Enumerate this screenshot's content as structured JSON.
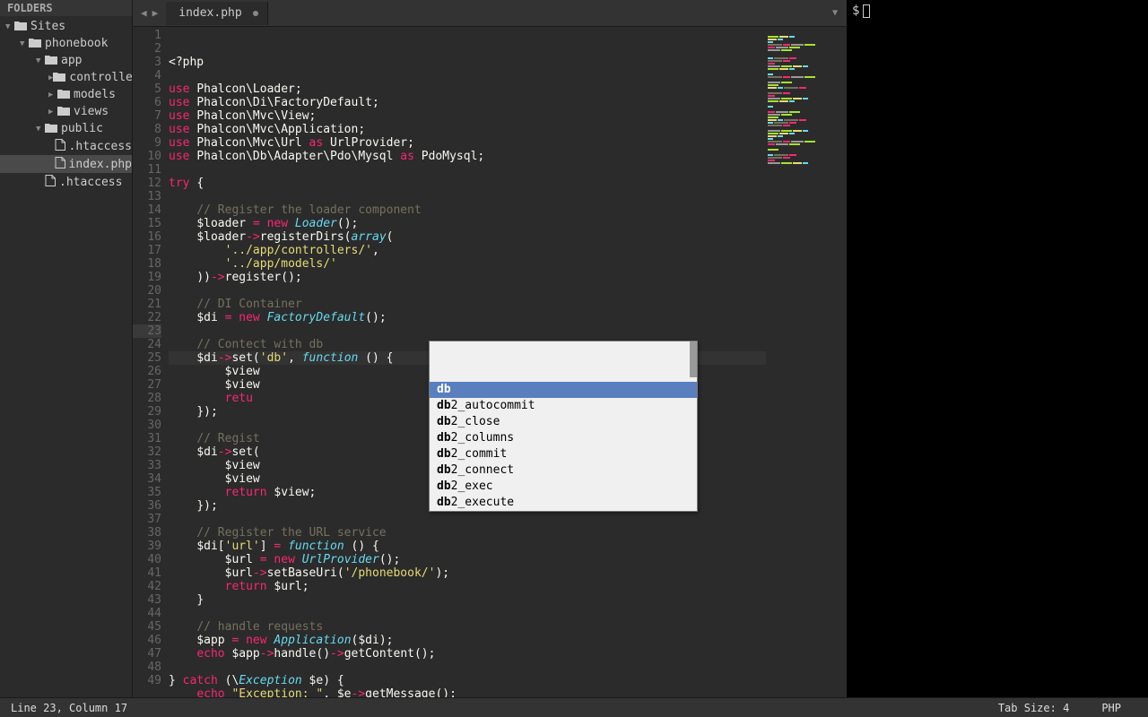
{
  "sidebar": {
    "header": "FOLDERS",
    "tree": [
      {
        "label": "Sites",
        "depth": 0,
        "type": "folder",
        "expanded": true,
        "selected": false
      },
      {
        "label": "phonebook",
        "depth": 1,
        "type": "folder",
        "expanded": true,
        "selected": false
      },
      {
        "label": "app",
        "depth": 2,
        "type": "folder",
        "expanded": true,
        "selected": false
      },
      {
        "label": "controllers",
        "depth": 3,
        "type": "folder",
        "expanded": false,
        "selected": false
      },
      {
        "label": "models",
        "depth": 3,
        "type": "folder",
        "expanded": false,
        "selected": false
      },
      {
        "label": "views",
        "depth": 3,
        "type": "folder",
        "expanded": false,
        "selected": false
      },
      {
        "label": "public",
        "depth": 2,
        "type": "folder",
        "expanded": true,
        "selected": false
      },
      {
        "label": ".htaccess",
        "depth": 3,
        "type": "file",
        "expanded": false,
        "selected": false
      },
      {
        "label": "index.php",
        "depth": 3,
        "type": "file",
        "expanded": false,
        "selected": true
      },
      {
        "label": ".htaccess",
        "depth": 2,
        "type": "file",
        "expanded": false,
        "selected": false
      }
    ]
  },
  "tabs": {
    "active": {
      "title": "index.php",
      "dirty": true
    }
  },
  "autocomplete": {
    "items": [
      {
        "prefix": "db",
        "suffix": "",
        "selected": true
      },
      {
        "prefix": "db",
        "suffix": "2_autocommit",
        "selected": false
      },
      {
        "prefix": "db",
        "suffix": "2_close",
        "selected": false
      },
      {
        "prefix": "db",
        "suffix": "2_columns",
        "selected": false
      },
      {
        "prefix": "db",
        "suffix": "2_commit",
        "selected": false
      },
      {
        "prefix": "db",
        "suffix": "2_connect",
        "selected": false
      },
      {
        "prefix": "db",
        "suffix": "2_exec",
        "selected": false
      },
      {
        "prefix": "db",
        "suffix": "2_execute",
        "selected": false
      }
    ]
  },
  "code": {
    "current_line": 23,
    "lines": [
      {
        "n": 1,
        "html": "<span class='k-white'>&lt;?php</span>"
      },
      {
        "n": 2,
        "html": ""
      },
      {
        "n": 3,
        "html": "<span class='k-red'>use</span> <span class='k-white'>Phalcon\\Loader;</span>"
      },
      {
        "n": 4,
        "html": "<span class='k-red'>use</span> <span class='k-white'>Phalcon\\Di\\FactoryDefault;</span>"
      },
      {
        "n": 5,
        "html": "<span class='k-red'>use</span> <span class='k-white'>Phalcon\\Mvc\\View;</span>"
      },
      {
        "n": 6,
        "html": "<span class='k-red'>use</span> <span class='k-white'>Phalcon\\Mvc\\Application;</span>"
      },
      {
        "n": 7,
        "html": "<span class='k-red'>use</span> <span class='k-white'>Phalcon\\Mvc\\Url </span><span class='k-red'>as</span><span class='k-white'> UrlProvider;</span>"
      },
      {
        "n": 8,
        "html": "<span class='k-red'>use</span> <span class='k-white'>Phalcon\\Db\\Adapter\\Pdo\\Mysql </span><span class='k-red'>as</span><span class='k-white'> PdoMysql;</span>"
      },
      {
        "n": 9,
        "html": ""
      },
      {
        "n": 10,
        "html": "<span class='k-red'>try</span> <span class='k-white'>{</span>"
      },
      {
        "n": 11,
        "html": ""
      },
      {
        "n": 12,
        "html": "    <span class='k-gray'>// Register the loader component</span>"
      },
      {
        "n": 13,
        "html": "    <span class='k-white'>$loader </span><span class='k-red'>=</span> <span class='k-red'>new</span> <span class='k-blue'>Loader</span><span class='k-white'>();</span>"
      },
      {
        "n": 14,
        "html": "    <span class='k-white'>$loader</span><span class='k-red'>-&gt;</span><span class='k-white'>registerDirs(</span><span class='k-blue'>array</span><span class='k-white'>(</span>"
      },
      {
        "n": 15,
        "html": "        <span class='k-yellow'>'../app/controllers/'</span><span class='k-white'>,</span>"
      },
      {
        "n": 16,
        "html": "        <span class='k-yellow'>'../app/models/'</span>"
      },
      {
        "n": 17,
        "html": "    <span class='k-white'>))</span><span class='k-red'>-&gt;</span><span class='k-white'>register();</span>"
      },
      {
        "n": 18,
        "html": ""
      },
      {
        "n": 19,
        "html": "    <span class='k-gray'>// DI Container</span>"
      },
      {
        "n": 20,
        "html": "    <span class='k-white'>$di </span><span class='k-red'>=</span> <span class='k-red'>new</span> <span class='k-blue'>FactoryDefault</span><span class='k-white'>();</span>"
      },
      {
        "n": 21,
        "html": ""
      },
      {
        "n": 22,
        "html": "    <span class='k-gray'>// Contect with db</span>"
      },
      {
        "n": 23,
        "html": "    <span class='k-white'>$di</span><span class='k-red'>-&gt;</span><span class='k-white'>set(</span><span class='k-yellow'>'db'</span><span class='k-white'>, </span><span class='k-blue'>function</span><span class='k-white'> () {</span>"
      },
      {
        "n": 24,
        "html": "        <span class='k-white'>$view</span>"
      },
      {
        "n": 25,
        "html": "        <span class='k-white'>$view</span>"
      },
      {
        "n": 26,
        "html": "        <span class='k-red'>retu</span>"
      },
      {
        "n": 27,
        "html": "    <span class='k-white'>});</span>"
      },
      {
        "n": 28,
        "html": ""
      },
      {
        "n": 29,
        "html": "    <span class='k-gray'>// Regist</span>"
      },
      {
        "n": 30,
        "html": "    <span class='k-white'>$di</span><span class='k-red'>-&gt;</span><span class='k-white'>set(</span>"
      },
      {
        "n": 31,
        "html": "        <span class='k-white'>$view</span>"
      },
      {
        "n": 32,
        "html": "        <span class='k-white'>$view</span>"
      },
      {
        "n": 33,
        "html": "        <span class='k-red'>return</span> <span class='k-white'>$view;</span>"
      },
      {
        "n": 34,
        "html": "    <span class='k-white'>});</span>"
      },
      {
        "n": 35,
        "html": ""
      },
      {
        "n": 36,
        "html": "    <span class='k-gray'>// Register the URL service</span>"
      },
      {
        "n": 37,
        "html": "    <span class='k-white'>$di[</span><span class='k-yellow'>'url'</span><span class='k-white'>] </span><span class='k-red'>=</span> <span class='k-blue'>function</span><span class='k-white'> () {</span>"
      },
      {
        "n": 38,
        "html": "        <span class='k-white'>$url </span><span class='k-red'>=</span> <span class='k-red'>new</span> <span class='k-blue'>UrlProvider</span><span class='k-white'>();</span>"
      },
      {
        "n": 39,
        "html": "        <span class='k-white'>$url</span><span class='k-red'>-&gt;</span><span class='k-white'>setBaseUri(</span><span class='k-yellow'>'/phonebook/'</span><span class='k-white'>);</span>"
      },
      {
        "n": 40,
        "html": "        <span class='k-red'>return</span> <span class='k-white'>$url;</span>"
      },
      {
        "n": 41,
        "html": "    <span class='k-white'>}</span>"
      },
      {
        "n": 42,
        "html": ""
      },
      {
        "n": 43,
        "html": "    <span class='k-gray'>// handle requests</span>"
      },
      {
        "n": 44,
        "html": "    <span class='k-white'>$app </span><span class='k-red'>=</span> <span class='k-red'>new</span> <span class='k-blue'>Application</span><span class='k-white'>($di);</span>"
      },
      {
        "n": 45,
        "html": "    <span class='k-red'>echo</span> <span class='k-white'>$app</span><span class='k-red'>-&gt;</span><span class='k-white'>handle()</span><span class='k-red'>-&gt;</span><span class='k-white'>getContent();</span>"
      },
      {
        "n": 46,
        "html": ""
      },
      {
        "n": 47,
        "html": "<span class='k-white'>} </span><span class='k-red'>catch</span><span class='k-white'> (\\</span><span class='k-blue'>Exception</span><span class='k-white'> $e) {</span>"
      },
      {
        "n": 48,
        "html": "    <span class='k-red'>echo</span> <span class='k-yellow'>\"Exception: \"</span><span class='k-white'>, $e</span><span class='k-red'>-&gt;</span><span class='k-white'>getMessage();</span>"
      },
      {
        "n": 49,
        "html": "<span class='k-white'>}</span>"
      }
    ]
  },
  "terminal": {
    "prompt": "$"
  },
  "status": {
    "position": "Line 23, Column 17",
    "tabsize": "Tab Size: 4",
    "lang": "PHP"
  }
}
